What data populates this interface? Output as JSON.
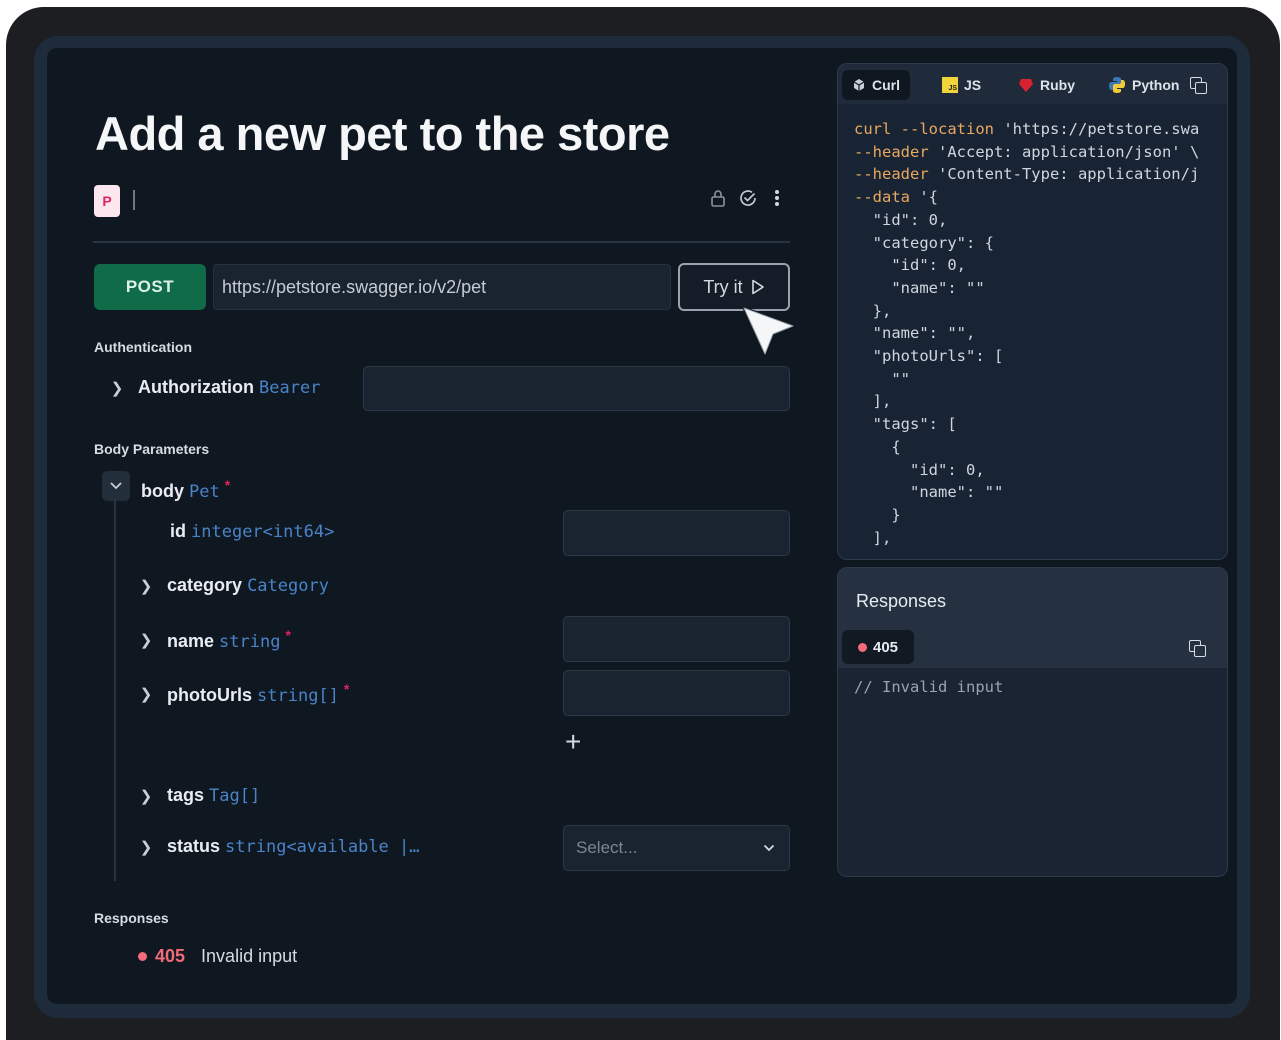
{
  "page": {
    "title": "Add a new pet to the store",
    "badge_letter": "P"
  },
  "request": {
    "method": "POST",
    "url": "https://petstore.swagger.io/v2/pet",
    "try_label": "Try it"
  },
  "auth": {
    "section_label": "Authentication",
    "name": "Authorization",
    "type": "Bearer",
    "value": ""
  },
  "body": {
    "section_label": "Body Parameters",
    "root": {
      "name": "body",
      "type": "Pet",
      "required": "*"
    },
    "params": [
      {
        "name": "id",
        "type": "integer<int64>",
        "required": ""
      },
      {
        "name": "category",
        "type": "Category",
        "required": ""
      },
      {
        "name": "name",
        "type": "string",
        "required": "*"
      },
      {
        "name": "photoUrls",
        "type": "string[]",
        "required": "*"
      },
      {
        "name": "tags",
        "type": "Tag[]",
        "required": ""
      },
      {
        "name": "status",
        "type": "string<available |…",
        "required": ""
      }
    ],
    "add_label": "+",
    "status_placeholder": "Select..."
  },
  "responses": {
    "section_label": "Responses",
    "items": [
      {
        "code": "405",
        "description": "Invalid input"
      }
    ]
  },
  "code_panel": {
    "tabs": [
      {
        "label": "Curl",
        "icon": "curl-icon"
      },
      {
        "label": "JS",
        "icon": "js-icon"
      },
      {
        "label": "Ruby",
        "icon": "ruby-icon"
      },
      {
        "label": "Python",
        "icon": "python-icon"
      }
    ],
    "active_tab": "Curl",
    "lines": [
      "curl --location 'https://petstore.swa",
      "--header 'Accept: application/json' \\",
      "--header 'Content-Type: application/j",
      "--data '{",
      "  \"id\": 0,",
      "  \"category\": {",
      "    \"id\": 0,",
      "    \"name\": \"\"",
      "  },",
      "  \"name\": \"\",",
      "  \"photoUrls\": [",
      "    \"\"",
      "  ],",
      "  \"tags\": [",
      "    {",
      "      \"id\": 0,",
      "      \"name\": \"\"",
      "    }",
      "  ],"
    ]
  },
  "response_panel": {
    "title": "Responses",
    "code": "405",
    "body": "// Invalid input"
  },
  "colors": {
    "post": "#0f6b48",
    "type": "#4a83c8",
    "required": "#e0245e",
    "error_dot": "#f26b7a"
  }
}
